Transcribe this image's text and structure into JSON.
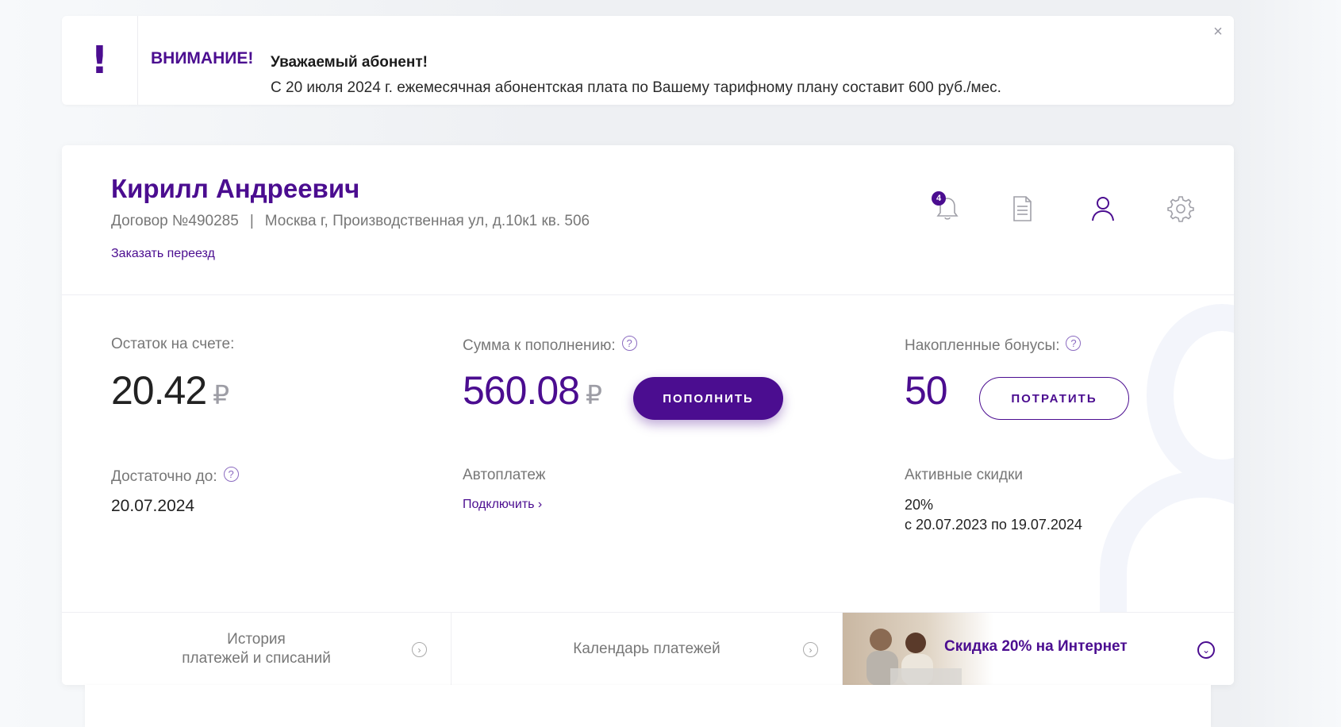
{
  "notice": {
    "mark": "!",
    "title": "ВНИМАНИЕ!",
    "heading": "Уважаемый абонент!",
    "text": "С 20 июля 2024 г. ежемесячная абонентская плата по Вашему тарифному плану составит 600 руб./мес.",
    "close": "×"
  },
  "profile": {
    "name": "Кирилл Андреевич",
    "contract": "Договор №490285",
    "separator": "|",
    "address": "Москва г, Производственная ул, д.10к1 кв. 506",
    "move_link": "Заказать переезд"
  },
  "header_icons": {
    "notifications_count": "4",
    "icons": [
      "bell-icon",
      "document-icon",
      "user-icon",
      "gear-icon"
    ]
  },
  "balance": {
    "label": "Остаток на счете:",
    "value": "20.42",
    "currency": "₽"
  },
  "topup": {
    "label": "Сумма к пополнению:",
    "help": "?",
    "value": "560.08",
    "currency": "₽",
    "button": "ПОПОЛНИТЬ"
  },
  "bonuses": {
    "label": "Накопленные бонусы:",
    "help": "?",
    "value": "50",
    "button": "ПОТРАТИТЬ"
  },
  "enough_until": {
    "label": "Достаточно до:",
    "help": "?",
    "value": "20.07.2024"
  },
  "autopay": {
    "label": "Автоплатеж",
    "link": "Подключить ›"
  },
  "discounts": {
    "label": "Активные скидки",
    "percent": "20%",
    "period": "с 20.07.2023 по 19.07.2024"
  },
  "strip": {
    "history_line1": "История",
    "history_line2": "платежей и списаний",
    "calendar": "Календарь платежей",
    "arrow": "›",
    "promo": "Скидка 20% на Интернет",
    "promo_toggle": "⌄"
  },
  "colors": {
    "brand": "#4b0d90",
    "muted": "#777777"
  }
}
